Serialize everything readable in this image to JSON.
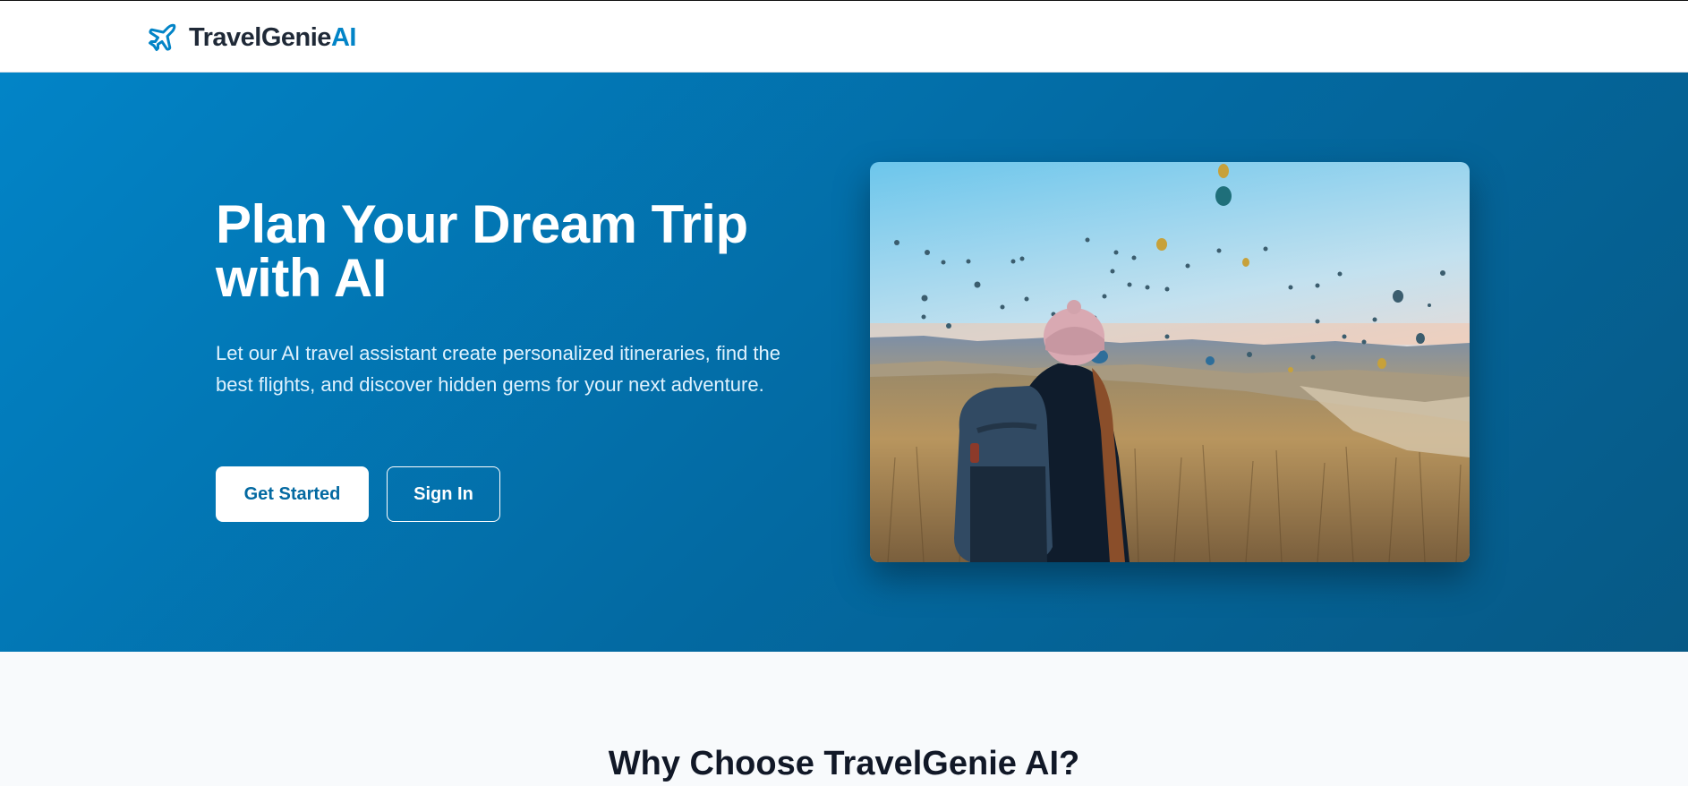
{
  "header": {
    "brand_name": "TravelGenie",
    "brand_accent": "AI",
    "logo_icon": "plane-icon"
  },
  "hero": {
    "title": "Plan Your Dream Trip with AI",
    "description": "Let our AI travel assistant create personalized itineraries, find the best flights, and discover hidden gems for your next adventure.",
    "primary_button": "Get Started",
    "secondary_button": "Sign In",
    "image_subject": "traveler-with-backpack-watching-hot-air-balloons"
  },
  "features": {
    "title": "Why Choose TravelGenie AI?"
  },
  "colors": {
    "brand_accent": "#0284c7",
    "hero_gradient_start": "#0284c7",
    "hero_gradient_end": "#075985",
    "primary_button_text": "#0369a1"
  }
}
